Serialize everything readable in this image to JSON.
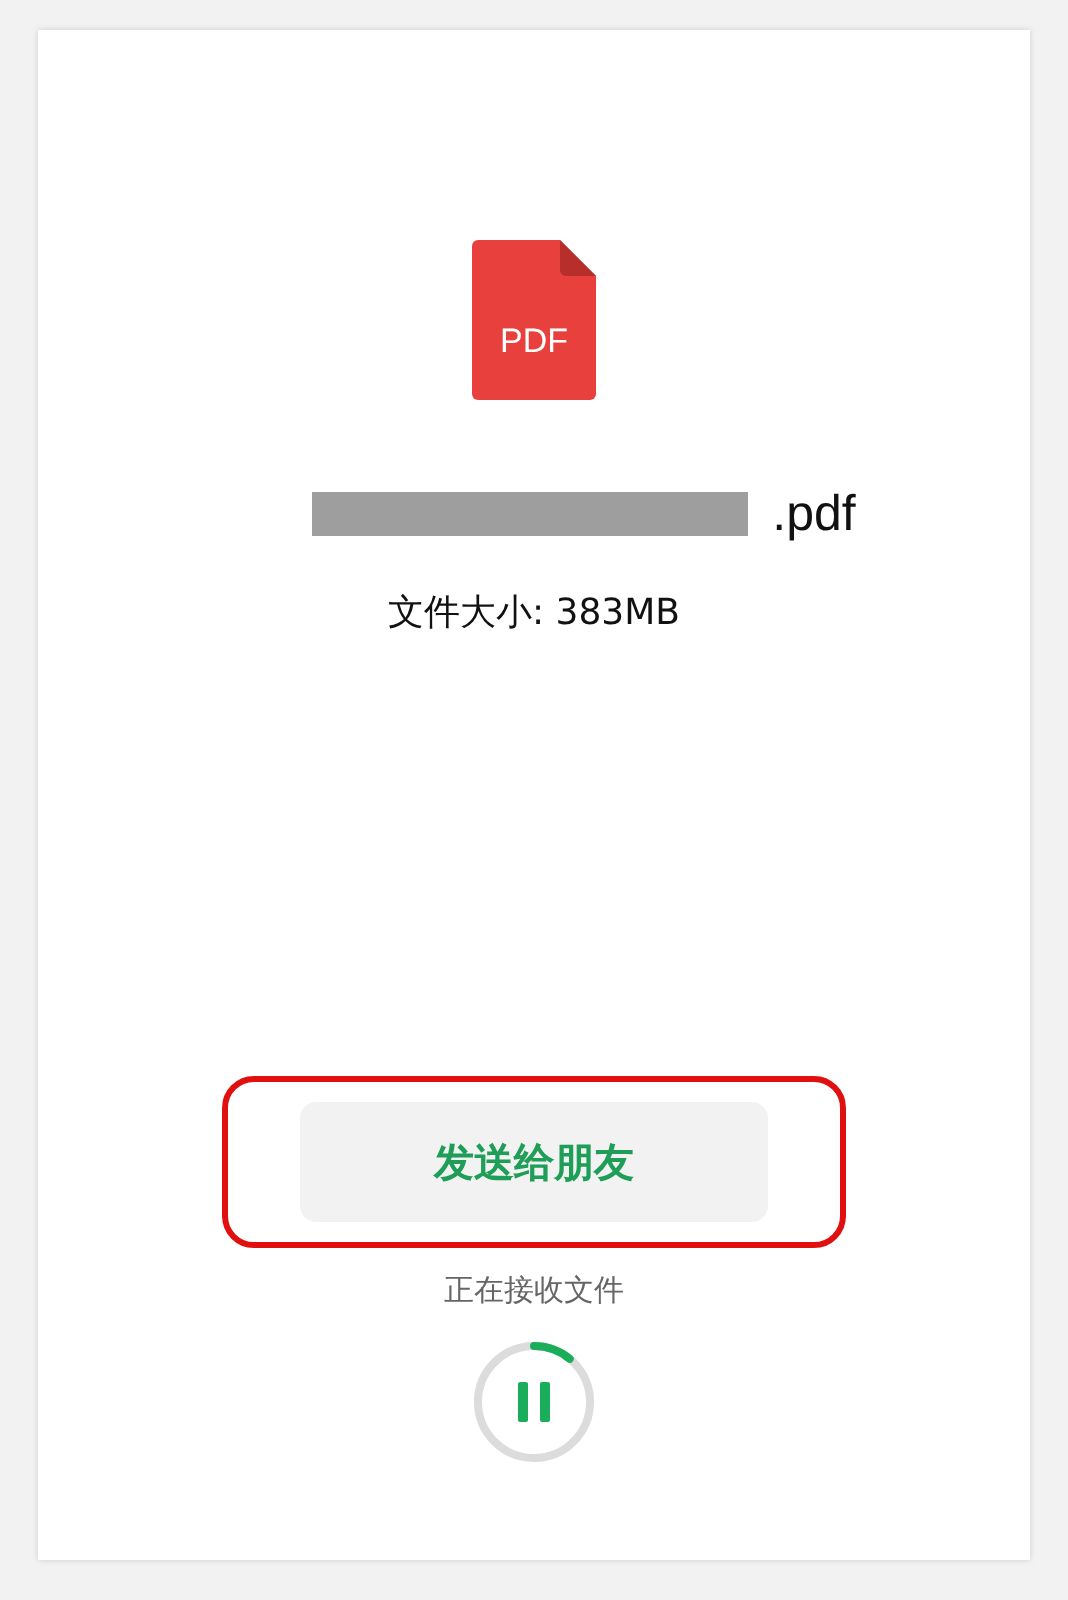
{
  "file": {
    "icon_label": "PDF",
    "name_redacted": true,
    "extension": ".pdf",
    "size_label": "文件大小: 383MB"
  },
  "send_button": {
    "label": "发送给朋友",
    "highlighted": true
  },
  "status": "正在接收文件",
  "progress": {
    "level": 0.11,
    "paused": false
  }
}
